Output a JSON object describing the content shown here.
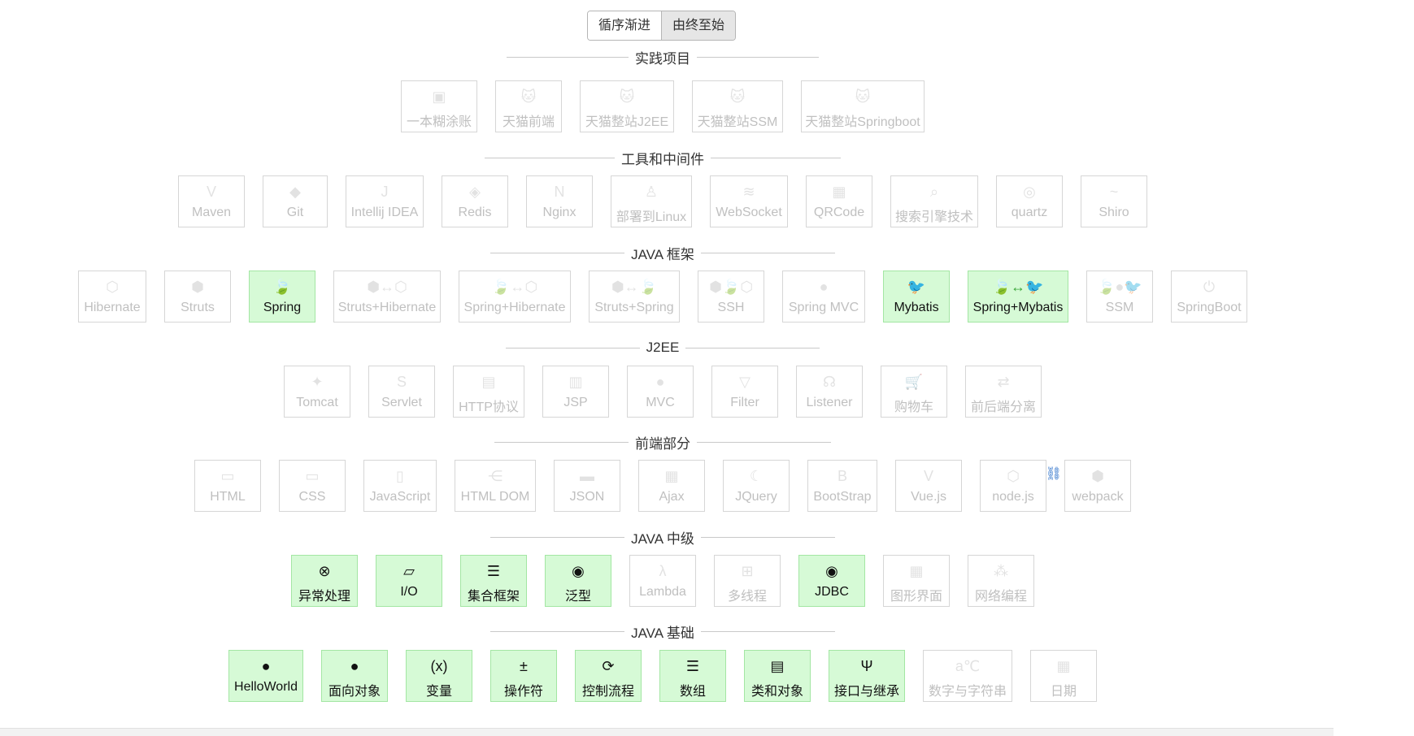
{
  "toggle": {
    "forward": "循序渐进",
    "reverse": "由终至始",
    "active": "reverse"
  },
  "sections": {
    "practice": "实践项目",
    "tools": "工具和中间件",
    "frameworks": "JAVA 框架",
    "j2ee": "J2EE",
    "frontend": "前端部分",
    "intermediate": "JAVA 中级",
    "basics": "JAVA 基础"
  },
  "practice": [
    {
      "label": "一本糊涂账",
      "icon": "wallet-icon",
      "on": false
    },
    {
      "label": "天猫前端",
      "icon": "tmall-icon",
      "on": false
    },
    {
      "label": "天猫整站J2EE",
      "icon": "tmall-j2ee-icon",
      "on": false
    },
    {
      "label": "天猫整站SSM",
      "icon": "tmall-ssm-icon",
      "on": false
    },
    {
      "label": "天猫整站Springboot",
      "icon": "tmall-boot-icon",
      "on": false
    }
  ],
  "tools": [
    {
      "label": "Maven",
      "icon": "maven-icon",
      "on": false
    },
    {
      "label": "Git",
      "icon": "git-icon",
      "on": false
    },
    {
      "label": "Intellij IDEA",
      "icon": "idea-icon",
      "on": false
    },
    {
      "label": "Redis",
      "icon": "redis-icon",
      "on": false
    },
    {
      "label": "Nginx",
      "icon": "nginx-icon",
      "on": false
    },
    {
      "label": "部署到Linux",
      "icon": "linux-icon",
      "on": false
    },
    {
      "label": "WebSocket",
      "icon": "websocket-icon",
      "on": false
    },
    {
      "label": "QRCode",
      "icon": "qrcode-icon",
      "on": false
    },
    {
      "label": "搜索引擎技术",
      "icon": "search-icon",
      "on": false
    },
    {
      "label": "quartz",
      "icon": "quartz-icon",
      "on": false
    },
    {
      "label": "Shiro",
      "icon": "shiro-icon",
      "on": false
    }
  ],
  "frameworks": [
    {
      "label": "Hibernate",
      "icon": "hibernate-icon",
      "on": false
    },
    {
      "label": "Struts",
      "icon": "struts-icon",
      "on": false
    },
    {
      "label": "Spring",
      "icon": "spring-leaf-icon",
      "on": true
    },
    {
      "label": "Struts+Hibernate",
      "icon": "struts-hibernate-icon",
      "on": false
    },
    {
      "label": "Spring+Hibernate",
      "icon": "spring-hibernate-icon",
      "on": false
    },
    {
      "label": "Struts+Spring",
      "icon": "struts-spring-icon",
      "on": false
    },
    {
      "label": "SSH",
      "icon": "ssh-icon",
      "on": false
    },
    {
      "label": "Spring MVC",
      "icon": "mvc-icon",
      "on": false
    },
    {
      "label": "Mybatis",
      "icon": "mybatis-bird-icon",
      "on": true
    },
    {
      "label": "Spring+Mybatis",
      "icon": "spring-mybatis-icon",
      "on": true
    },
    {
      "label": "SSM",
      "icon": "ssm-icon",
      "on": false
    },
    {
      "label": "SpringBoot",
      "icon": "springboot-icon",
      "on": false
    }
  ],
  "j2ee": [
    {
      "label": "Tomcat",
      "icon": "tomcat-icon",
      "on": false
    },
    {
      "label": "Servlet",
      "icon": "servlet-icon",
      "on": false
    },
    {
      "label": "HTTP协议",
      "icon": "http-icon",
      "on": false
    },
    {
      "label": "JSP",
      "icon": "jsp-icon",
      "on": false
    },
    {
      "label": "MVC",
      "icon": "mvc-icon",
      "on": false
    },
    {
      "label": "Filter",
      "icon": "filter-icon",
      "on": false
    },
    {
      "label": "Listener",
      "icon": "headset-icon",
      "on": false
    },
    {
      "label": "购物车",
      "icon": "cart-icon",
      "on": false
    },
    {
      "label": "前后端分离",
      "icon": "split-arrows-icon",
      "on": false
    }
  ],
  "frontend": [
    {
      "label": "HTML",
      "icon": "html-icon",
      "on": false
    },
    {
      "label": "CSS",
      "icon": "css-icon",
      "on": false
    },
    {
      "label": "JavaScript",
      "icon": "js-file-icon",
      "on": false
    },
    {
      "label": "HTML DOM",
      "icon": "dom-tree-icon",
      "on": false
    },
    {
      "label": "JSON",
      "icon": "json-icon",
      "on": false
    },
    {
      "label": "Ajax",
      "icon": "ajax-icon",
      "on": false
    },
    {
      "label": "JQuery",
      "icon": "jquery-icon",
      "on": false
    },
    {
      "label": "BootStrap",
      "icon": "bootstrap-icon",
      "on": false
    },
    {
      "label": "Vue.js",
      "icon": "vue-icon",
      "on": false
    },
    {
      "label": "node.js",
      "icon": "node-icon",
      "on": false
    },
    {
      "label": "webpack",
      "icon": "webpack-icon",
      "on": false
    }
  ],
  "intermediate": [
    {
      "label": "异常处理",
      "icon": "error-circle-icon",
      "on": true
    },
    {
      "label": "I/O",
      "icon": "file-icon",
      "on": true
    },
    {
      "label": "集合框架",
      "icon": "list-icon",
      "on": true
    },
    {
      "label": "泛型",
      "icon": "generic-box-icon",
      "on": true
    },
    {
      "label": "Lambda",
      "icon": "lambda-icon",
      "on": false
    },
    {
      "label": "多线程",
      "icon": "thread-tree-icon",
      "on": false
    },
    {
      "label": "JDBC",
      "icon": "database-icon",
      "on": true
    },
    {
      "label": "图形界面",
      "icon": "window-icon",
      "on": false
    },
    {
      "label": "网络编程",
      "icon": "network-icon",
      "on": false
    }
  ],
  "basics": [
    {
      "label": "HelloWorld",
      "icon": "hi-bubble-icon",
      "on": true
    },
    {
      "label": "面向对象",
      "icon": "object-icon",
      "on": true
    },
    {
      "label": "变量",
      "icon": "variable-icon",
      "on": true
    },
    {
      "label": "操作符",
      "icon": "operators-icon",
      "on": true
    },
    {
      "label": "控制流程",
      "icon": "loop-icon",
      "on": true
    },
    {
      "label": "数组",
      "icon": "bullet-list-icon",
      "on": true
    },
    {
      "label": "类和对象",
      "icon": "class-icon",
      "on": true
    },
    {
      "label": "接口与继承",
      "icon": "usb-icon",
      "on": true
    },
    {
      "label": "数字与字符串",
      "icon": "abc-icon",
      "on": false
    },
    {
      "label": "日期",
      "icon": "calendar-icon",
      "on": false
    }
  ],
  "link_badge_icon": "link-icon"
}
